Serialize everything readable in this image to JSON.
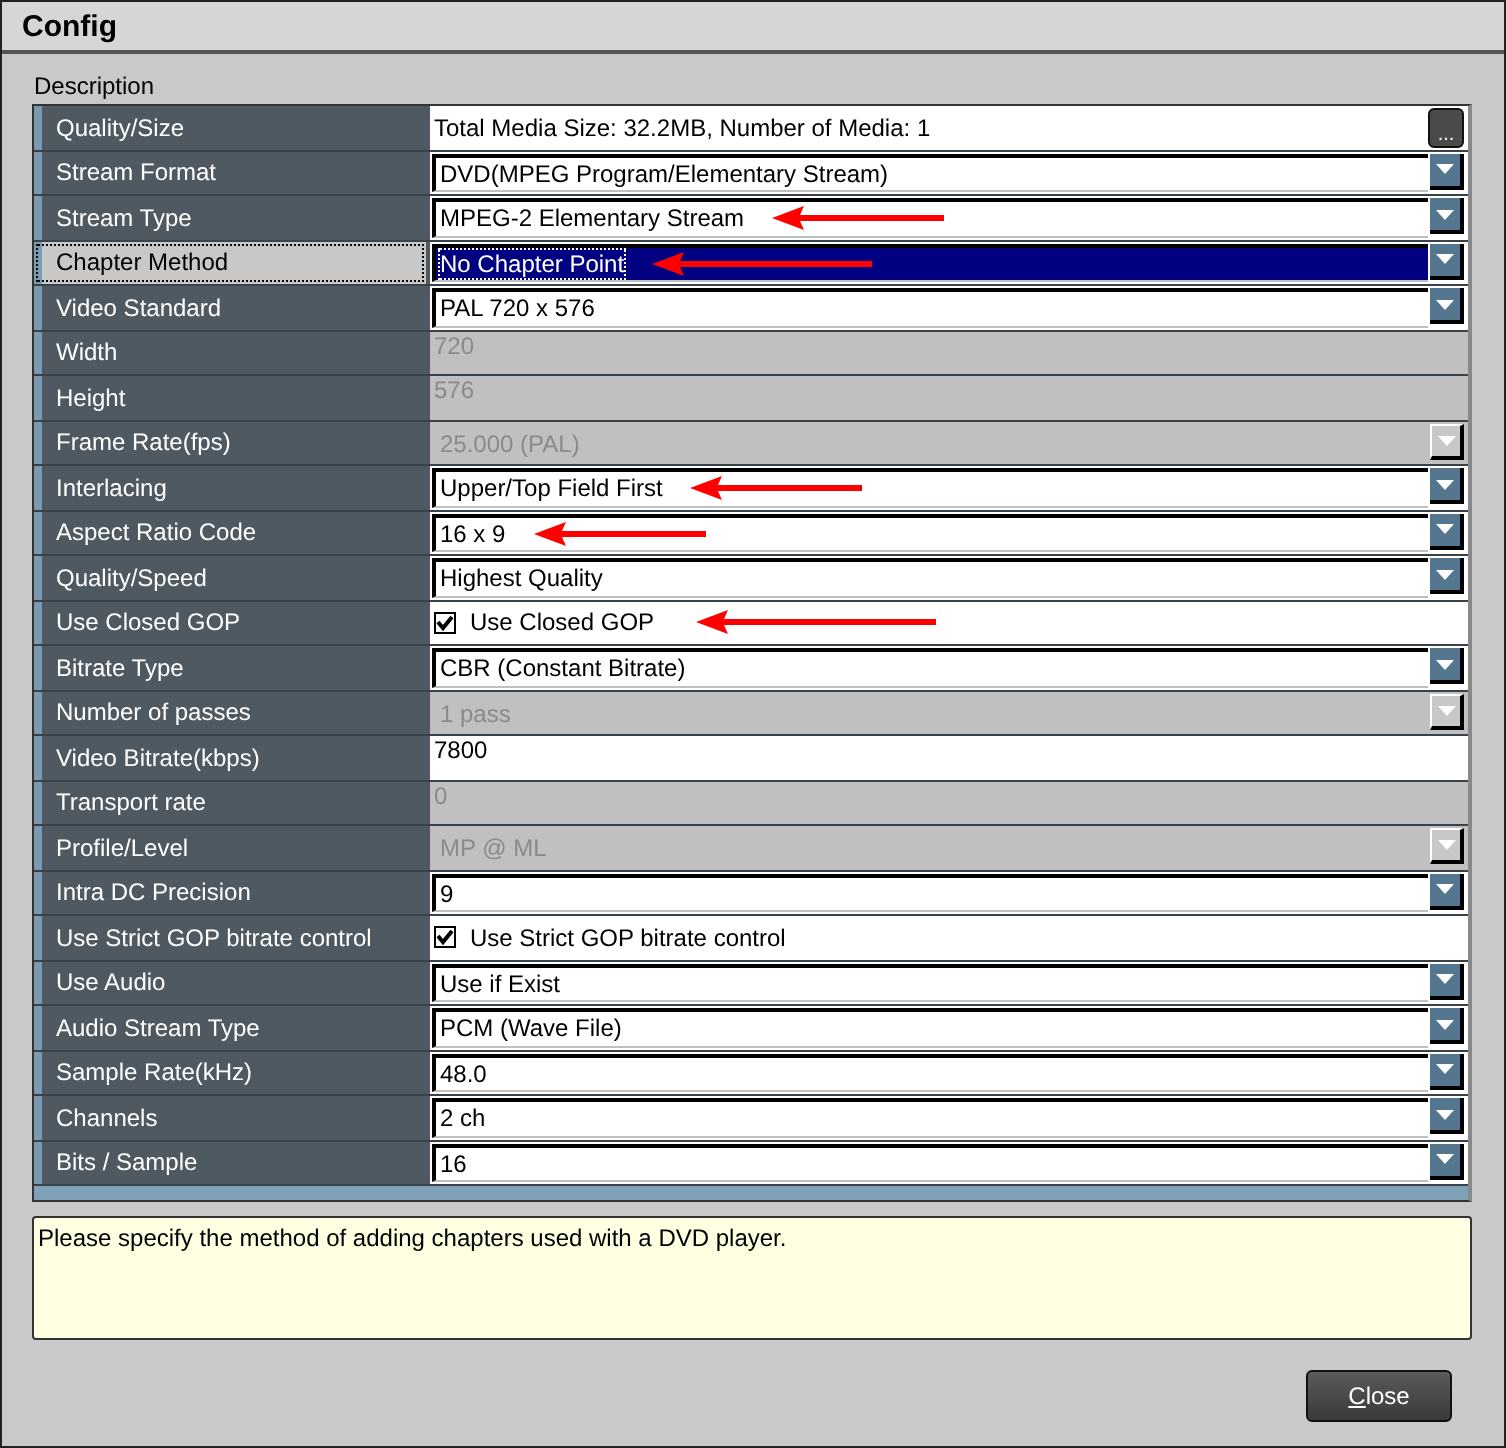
{
  "window": {
    "title": "Config"
  },
  "group_label": "Description",
  "rows": [
    {
      "label": "Quality/Size",
      "kind": "info",
      "value": "Total Media Size: 32.2MB, Number of Media: 1",
      "button": "...",
      "disabled": false,
      "selected": false
    },
    {
      "label": "Stream Format",
      "kind": "dropdown",
      "value": "DVD(MPEG Program/Elementary Stream)",
      "disabled": false,
      "selected": false
    },
    {
      "label": "Stream Type",
      "kind": "dropdown",
      "value": "MPEG-2 Elementary Stream",
      "disabled": false,
      "selected": false,
      "arrow": true
    },
    {
      "label": "Chapter Method",
      "kind": "dropdown",
      "value": "No Chapter Point",
      "disabled": false,
      "selected": true,
      "arrow": true
    },
    {
      "label": "Video Standard",
      "kind": "dropdown",
      "value": "PAL  720 x 576",
      "disabled": false,
      "selected": false
    },
    {
      "label": "Width",
      "kind": "text",
      "value": "720",
      "disabled": true,
      "selected": false
    },
    {
      "label": "Height",
      "kind": "text",
      "value": "576",
      "disabled": true,
      "selected": false
    },
    {
      "label": "Frame Rate(fps)",
      "kind": "dropdown",
      "value": "25.000 (PAL)",
      "disabled": true,
      "selected": false
    },
    {
      "label": "Interlacing",
      "kind": "dropdown",
      "value": "Upper/Top Field First",
      "disabled": false,
      "selected": false,
      "arrow": true
    },
    {
      "label": "Aspect Ratio Code",
      "kind": "dropdown",
      "value": "16 x 9",
      "disabled": false,
      "selected": false,
      "arrow": true
    },
    {
      "label": "Quality/Speed",
      "kind": "dropdown",
      "value": "Highest Quality",
      "disabled": false,
      "selected": false
    },
    {
      "label": "Use Closed GOP",
      "kind": "checkbox",
      "value": "Use Closed GOP",
      "checked": true,
      "disabled": false,
      "selected": false,
      "arrow": true
    },
    {
      "label": "Bitrate Type",
      "kind": "dropdown",
      "value": "CBR (Constant Bitrate)",
      "disabled": false,
      "selected": false
    },
    {
      "label": "Number of passes",
      "kind": "dropdown",
      "value": "1 pass",
      "disabled": true,
      "selected": false
    },
    {
      "label": "Video Bitrate(kbps)",
      "kind": "text",
      "value": "7800",
      "disabled": false,
      "selected": false
    },
    {
      "label": "Transport rate",
      "kind": "text",
      "value": "0",
      "disabled": true,
      "selected": false
    },
    {
      "label": "Profile/Level",
      "kind": "dropdown",
      "value": "MP @ ML",
      "disabled": true,
      "selected": false
    },
    {
      "label": "Intra DC Precision",
      "kind": "dropdown",
      "value": "9",
      "disabled": false,
      "selected": false
    },
    {
      "label": "Use Strict GOP bitrate control",
      "kind": "checkbox",
      "value": "Use Strict GOP bitrate control",
      "checked": true,
      "disabled": false,
      "selected": false
    },
    {
      "label": "Use Audio",
      "kind": "dropdown",
      "value": "Use if Exist",
      "disabled": false,
      "selected": false
    },
    {
      "label": "Audio Stream Type",
      "kind": "dropdown",
      "value": "PCM (Wave File)",
      "disabled": false,
      "selected": false
    },
    {
      "label": "Sample Rate(kHz)",
      "kind": "dropdown",
      "value": "48.0",
      "disabled": false,
      "selected": false
    },
    {
      "label": "Channels",
      "kind": "dropdown",
      "value": "2 ch",
      "disabled": false,
      "selected": false
    },
    {
      "label": "Bits / Sample",
      "kind": "dropdown",
      "value": "16",
      "disabled": false,
      "selected": false
    }
  ],
  "description": "Please specify the method of adding chapters used with a DVD player.",
  "buttons": [
    {
      "label": "Close",
      "mnemonic_first": true
    }
  ]
}
